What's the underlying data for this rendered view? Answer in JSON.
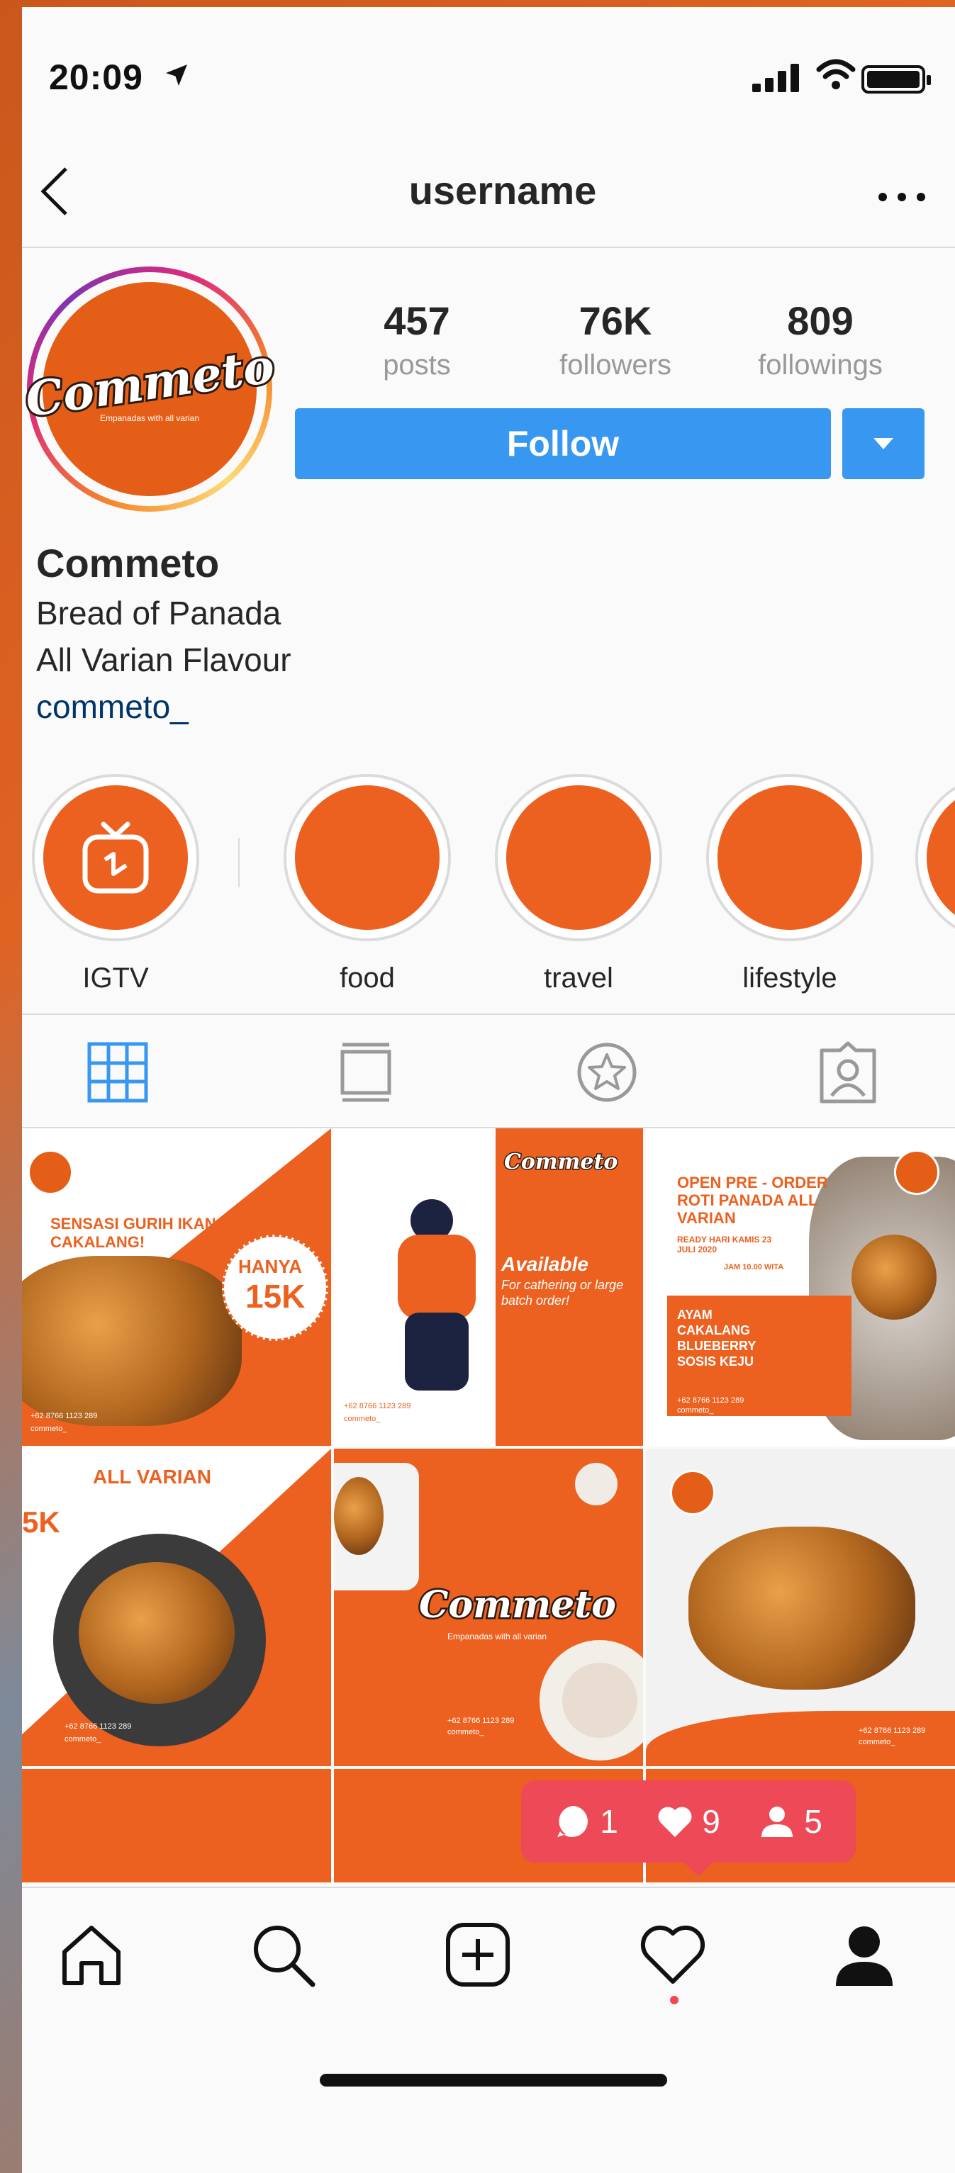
{
  "status": {
    "time": "20:09"
  },
  "header": {
    "username": "username"
  },
  "profile": {
    "logo_word": "Commeto",
    "logo_sub": "Empanadas with all varian",
    "stats": [
      {
        "count": "457",
        "label": "posts"
      },
      {
        "count": "76K",
        "label": "followers"
      },
      {
        "count": "809",
        "label": "followings"
      }
    ],
    "follow_label": "Follow",
    "name": "Commeto",
    "bio_line1": "Bread of Panada",
    "bio_line2": "All Varian Flavour",
    "link": "commeto_"
  },
  "highlights": [
    {
      "label": "IGTV"
    },
    {
      "label": "food"
    },
    {
      "label": "travel"
    },
    {
      "label": "lifestyle"
    }
  ],
  "posts": {
    "p1_headline": "SENSASI GURIH IKAN CAKALANG!",
    "p1_price_top": "HANYA",
    "p1_price": "15K",
    "p1_phone": "+62 8766 1123 289",
    "p1_handle": "commeto_",
    "p2_title": "Available",
    "p2_sub": "For cathering or large batch order!",
    "p2_phone": "+62 8766 1123 289",
    "p2_handle": "commeto_",
    "p3_headline": "OPEN PRE - ORDER ROTI PANADA ALL VARIAN",
    "p3_ready": "READY HARI KAMIS 23 JULI 2020",
    "p3_time": "JAM 10.00 WITA",
    "p3_list": "AYAM CAKALANG BLUEBERRY SOSIS KEJU",
    "p3_phone": "+62 8766 1123 289",
    "p3_handle": "commeto_",
    "p4_headline": "ALL VARIAN",
    "p4_price": "5K",
    "p4_phone": "+62 8766 1123 289",
    "p4_handle": "commeto_",
    "p5_logo": "Commeto",
    "p5_sub": "Empanadas with all varian",
    "p5_phone": "+62 8766 1123 289",
    "p5_handle": "commeto_",
    "p6_phone": "+62 8766 1123 289",
    "p6_handle": "commeto_"
  },
  "notification": {
    "comments": "1",
    "likes": "9",
    "follows": "5"
  },
  "colors": {
    "accent": "#3897f0",
    "brand": "#ec6120",
    "badge": "#ed4956"
  }
}
